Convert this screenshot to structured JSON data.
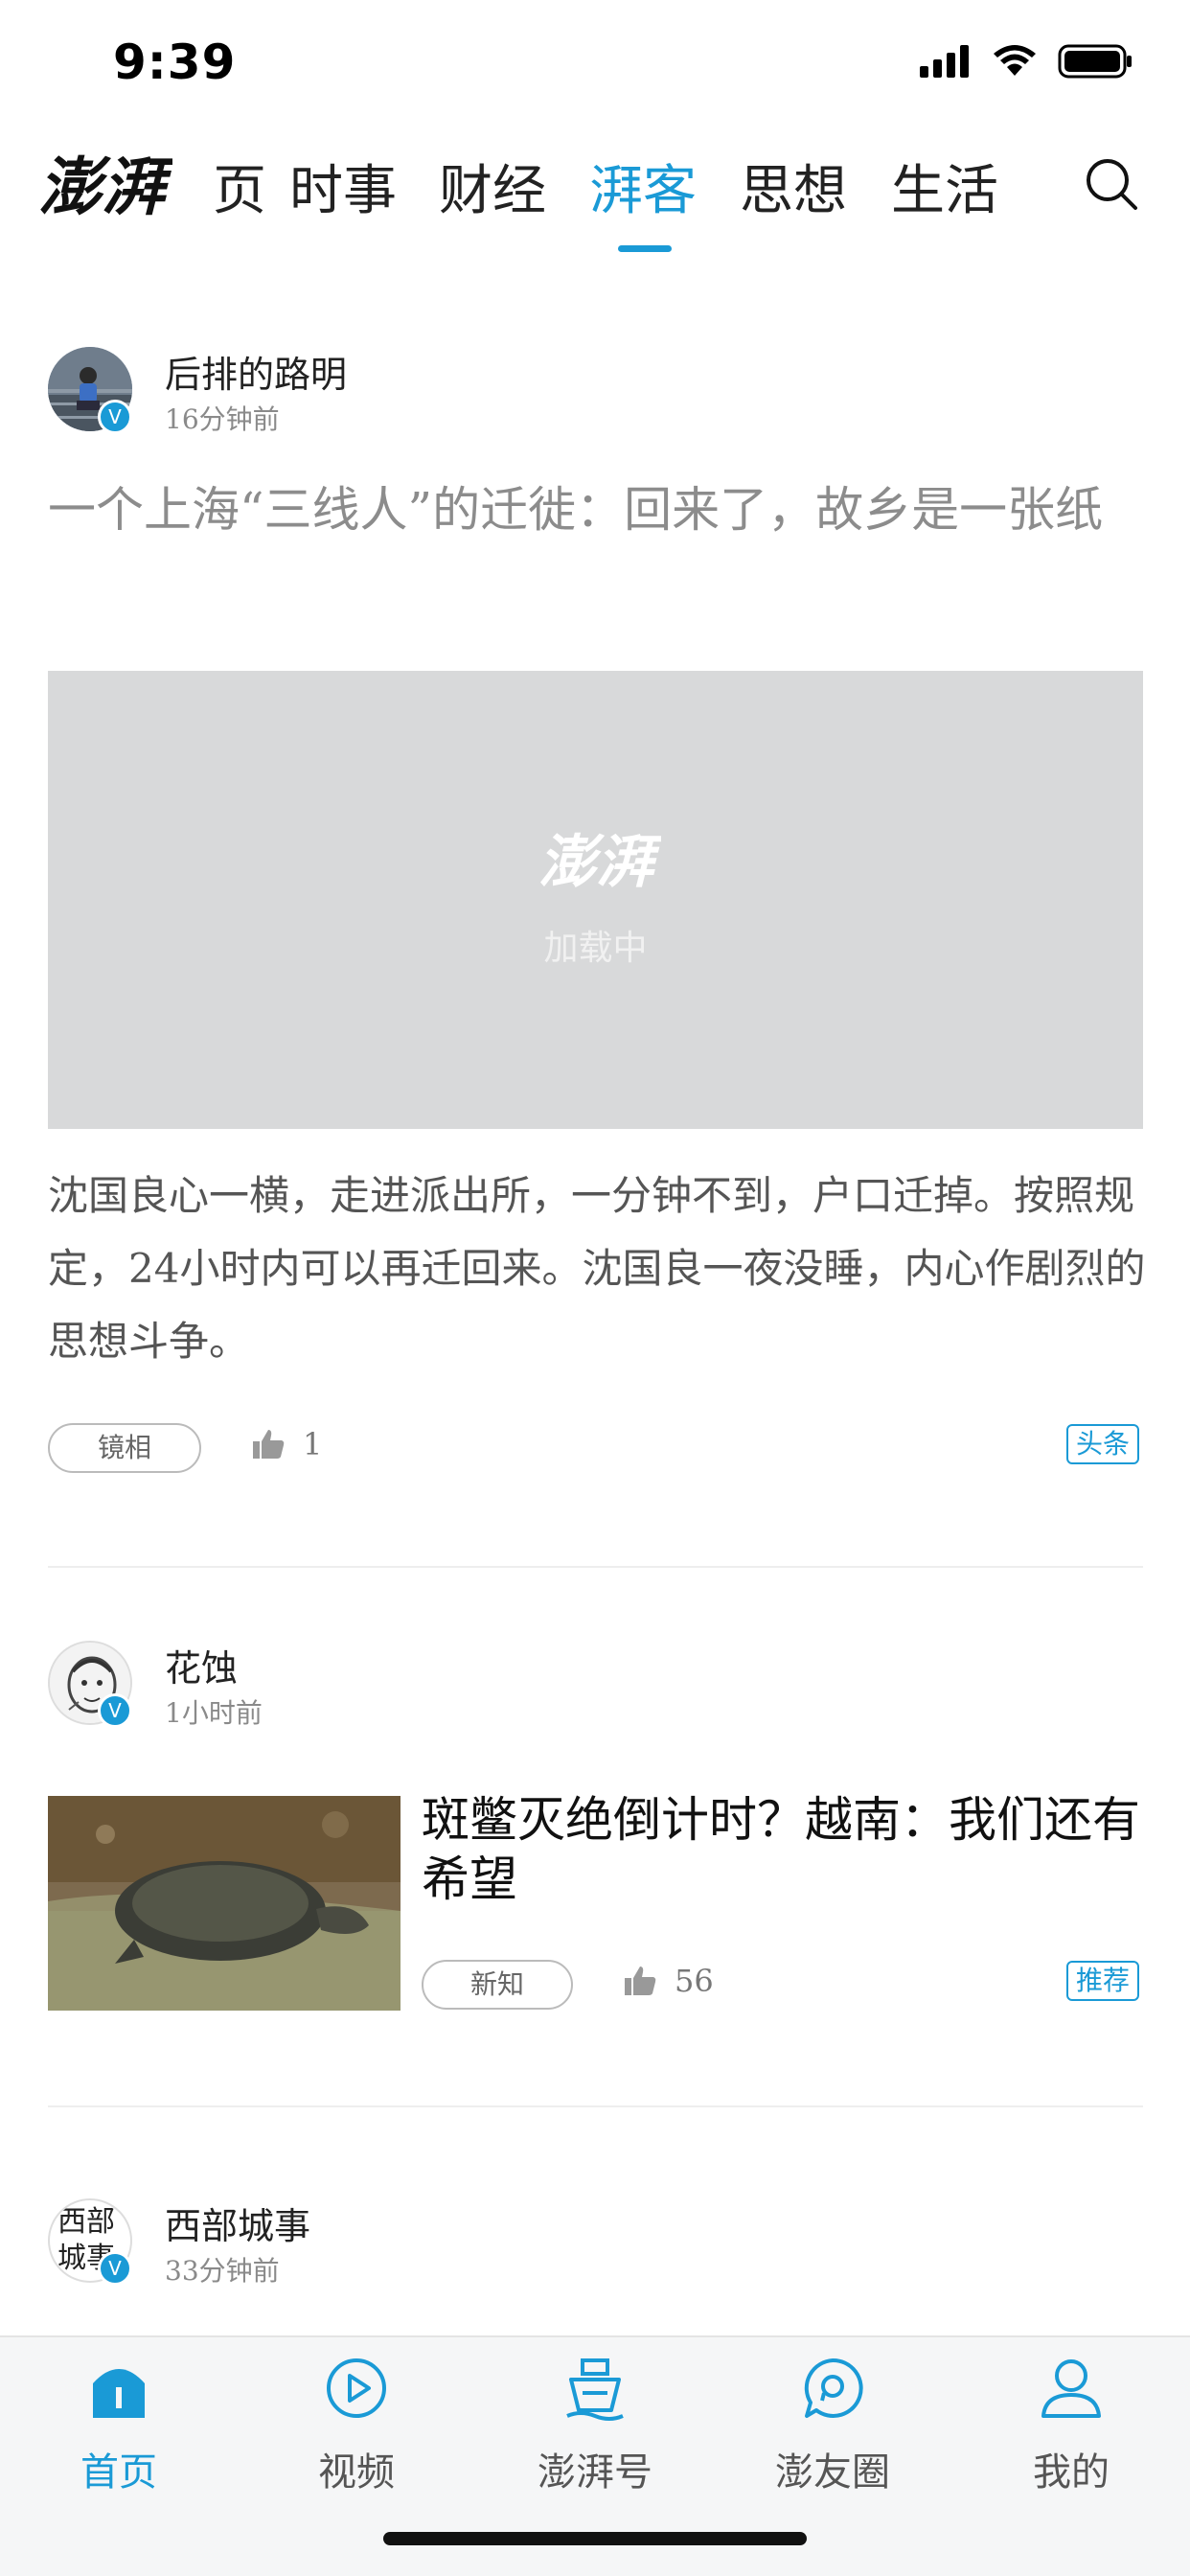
{
  "status_bar": {
    "time": "9:39"
  },
  "nav": {
    "logo": "澎湃",
    "tabs": [
      {
        "label": "页",
        "active": false
      },
      {
        "label": "时事",
        "active": false
      },
      {
        "label": "财经",
        "active": false
      },
      {
        "label": "湃客",
        "active": true
      },
      {
        "label": "思想",
        "active": false
      },
      {
        "label": "生活",
        "active": false
      }
    ],
    "search_icon": "search-icon"
  },
  "feed": [
    {
      "author": "后排的路明",
      "time": "16分钟前",
      "verified": "V",
      "title": "一个上海“三线人”的迁徙：回来了，故乡是一张纸",
      "image_placeholder": {
        "logo": "澎湃",
        "text": "加载中"
      },
      "summary": "沈国良心一横，走进派出所，一分钟不到，户口迁掉。按照规定，24小时内可以再迁回来。沈国良一夜没睡，内心作剧烈的思想斗争。",
      "tag": "镜相",
      "likes": "1",
      "badge": "头条"
    },
    {
      "author": "花蚀",
      "time": "1小时前",
      "verified": "V",
      "title": "斑鳖灭绝倒计时？越南：我们还有希望",
      "tag": "新知",
      "likes": "56",
      "badge": "推荐"
    },
    {
      "author": "西部城事",
      "avatar_text": "西部城事",
      "time": "33分钟前",
      "verified": "V"
    }
  ],
  "tab_bar": [
    {
      "label": "首页",
      "icon": "home-icon",
      "active": true
    },
    {
      "label": "视频",
      "icon": "video-icon",
      "active": false
    },
    {
      "label": "澎湃号",
      "icon": "boat-icon",
      "active": false
    },
    {
      "label": "澎友圈",
      "icon": "chat-bubble-icon",
      "active": false
    },
    {
      "label": "我的",
      "icon": "person-icon",
      "active": false
    }
  ],
  "colors": {
    "accent": "#1a9ad6",
    "placeholder_bg": "#d8d9da",
    "muted_text": "#8c8c8c"
  }
}
